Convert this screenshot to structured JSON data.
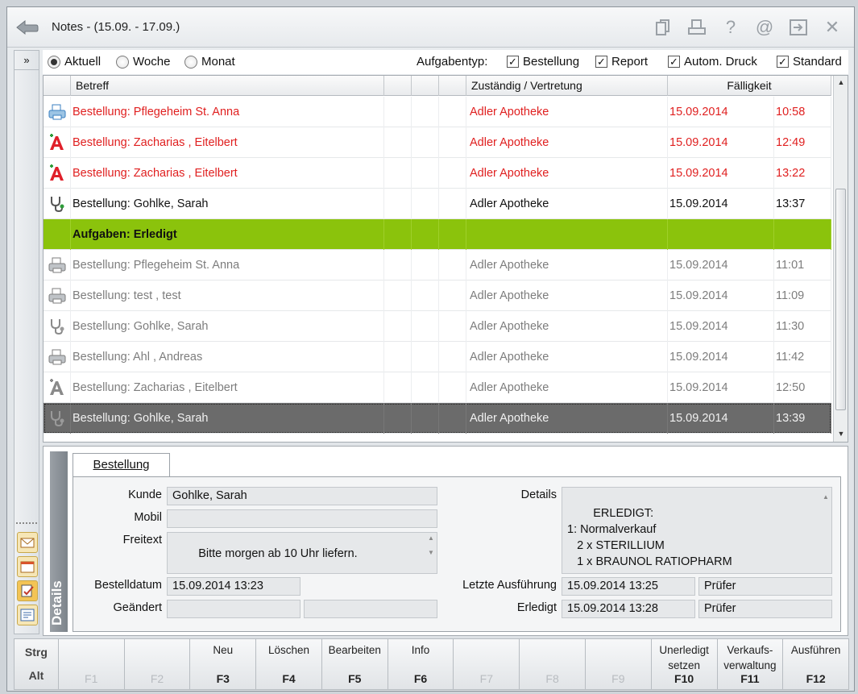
{
  "window": {
    "title": "Notes - (15.09. - 17.09.)"
  },
  "toolbar_icons": [
    "copy-icon",
    "print-icon",
    "help-icon",
    "email-icon",
    "export-icon",
    "close-icon"
  ],
  "toolbar_glyphs": {
    "help": "?",
    "email": "@",
    "close": "✕"
  },
  "sidebar": {
    "expand_label": "»"
  },
  "filters": {
    "radios": [
      {
        "label": "Aktuell",
        "selected": true
      },
      {
        "label": "Woche",
        "selected": false
      },
      {
        "label": "Monat",
        "selected": false
      }
    ],
    "type_label": "Aufgabentyp:",
    "checkboxes": [
      {
        "label": "Bestellung",
        "checked": true
      },
      {
        "label": "Report",
        "checked": true
      },
      {
        "label": "Autom. Druck",
        "checked": true
      },
      {
        "label": "Standard",
        "checked": true
      }
    ],
    "check_glyph": "✓"
  },
  "grid": {
    "headers": {
      "subject": "Betreff",
      "responsible": "Zuständig / Vertretung",
      "due": "Fälligkeit"
    },
    "rows": [
      {
        "icon": "printer-icon",
        "subject": "Bestellung: Pflegeheim St. Anna",
        "responsible": "Adler Apotheke",
        "date": "15.09.2014",
        "time": "10:58",
        "state": "red"
      },
      {
        "icon": "pharmacy-a-icon",
        "subject": "Bestellung: Zacharias , Eitelbert",
        "responsible": "Adler Apotheke",
        "date": "15.09.2014",
        "time": "12:49",
        "state": "red"
      },
      {
        "icon": "pharmacy-a-icon",
        "subject": "Bestellung: Zacharias , Eitelbert",
        "responsible": "Adler Apotheke",
        "date": "15.09.2014",
        "time": "13:22",
        "state": "red"
      },
      {
        "icon": "stethoscope-icon",
        "subject": "Bestellung: Gohlke, Sarah",
        "responsible": "Adler Apotheke",
        "date": "15.09.2014",
        "time": "13:37",
        "state": "black"
      },
      {
        "group": true,
        "subject": "Aufgaben: Erledigt"
      },
      {
        "icon": "printer-icon",
        "subject": "Bestellung: Pflegeheim St. Anna",
        "responsible": "Adler Apotheke",
        "date": "15.09.2014",
        "time": "11:01",
        "state": "gray"
      },
      {
        "icon": "printer-icon",
        "subject": "Bestellung: test , test",
        "responsible": "Adler Apotheke",
        "date": "15.09.2014",
        "time": "11:09",
        "state": "gray"
      },
      {
        "icon": "stethoscope-icon",
        "subject": "Bestellung: Gohlke, Sarah",
        "responsible": "Adler Apotheke",
        "date": "15.09.2014",
        "time": "11:30",
        "state": "gray"
      },
      {
        "icon": "printer-icon",
        "subject": "Bestellung: Ahl , Andreas",
        "responsible": "Adler Apotheke",
        "date": "15.09.2014",
        "time": "11:42",
        "state": "gray"
      },
      {
        "icon": "pharmacy-a-icon",
        "subject": "Bestellung: Zacharias , Eitelbert",
        "responsible": "Adler Apotheke",
        "date": "15.09.2014",
        "time": "12:50",
        "state": "gray"
      },
      {
        "icon": "stethoscope-icon",
        "subject": "Bestellung: Gohlke, Sarah",
        "responsible": "Adler Apotheke",
        "date": "15.09.2014",
        "time": "13:39",
        "state": "sel"
      }
    ]
  },
  "details": {
    "band_label": "Details",
    "tab_label": "Bestellung",
    "kunde_label": "Kunde",
    "kunde": "Gohlke, Sarah",
    "mobil_label": "Mobil",
    "mobil": "",
    "freitext_label": "Freitext",
    "freitext": "Bitte morgen ab 10 Uhr liefern.",
    "bestelldatum_label": "Bestelldatum",
    "bestelldatum": "15.09.2014 13:23",
    "geaendert_label": "Geändert",
    "geaendert": "",
    "geaendert_by": "",
    "details_label": "Details",
    "details_text": "ERLEDIGT:\n1: Normalverkauf\n   2 x STERILLIUM\n   1 x BRAUNOL RATIOPHARM",
    "letzte_label": "Letzte Ausführung",
    "letzte": "15.09.2014 13:25",
    "letzte_by": "Prüfer",
    "erledigt_label": "Erledigt",
    "erledigt": "15.09.2014 13:28",
    "erledigt_by": "Prüfer"
  },
  "fkeys": {
    "strg": "Strg",
    "alt": "Alt",
    "keys": [
      {
        "label": "",
        "key": "F1",
        "enabled": false
      },
      {
        "label": "",
        "key": "F2",
        "enabled": false
      },
      {
        "label": "Neu",
        "key": "F3",
        "enabled": true
      },
      {
        "label": "Löschen",
        "key": "F4",
        "enabled": true
      },
      {
        "label": "Bearbeiten",
        "key": "F5",
        "enabled": true
      },
      {
        "label": "Info",
        "key": "F6",
        "enabled": true
      },
      {
        "label": "",
        "key": "F7",
        "enabled": false
      },
      {
        "label": "",
        "key": "F8",
        "enabled": false
      },
      {
        "label": "",
        "key": "F9",
        "enabled": false
      },
      {
        "label": "Unerledigt setzen",
        "key": "F10",
        "enabled": true
      },
      {
        "label": "Verkaufs-verwaltung",
        "key": "F11",
        "enabled": true
      },
      {
        "label": "Ausführen",
        "key": "F12",
        "enabled": true
      }
    ]
  }
}
